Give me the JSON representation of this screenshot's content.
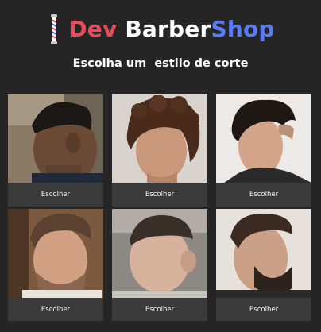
{
  "brand": {
    "word1": "Dev",
    "word2": "Barber",
    "word3": "Shop",
    "logo_icon": "barber-pole-icon"
  },
  "subtitle": "Escolha um  estilo de corte",
  "styles": [
    {
      "button": "Escolher"
    },
    {
      "button": "Escolher"
    },
    {
      "button": "Escolher"
    },
    {
      "button": "Escolher"
    },
    {
      "button": "Escolher"
    },
    {
      "button": "Escolher"
    }
  ],
  "colors": {
    "background": "#252525",
    "card": "#3a3a3a",
    "dev": "#ea4b59",
    "shop": "#5a7bf6"
  }
}
